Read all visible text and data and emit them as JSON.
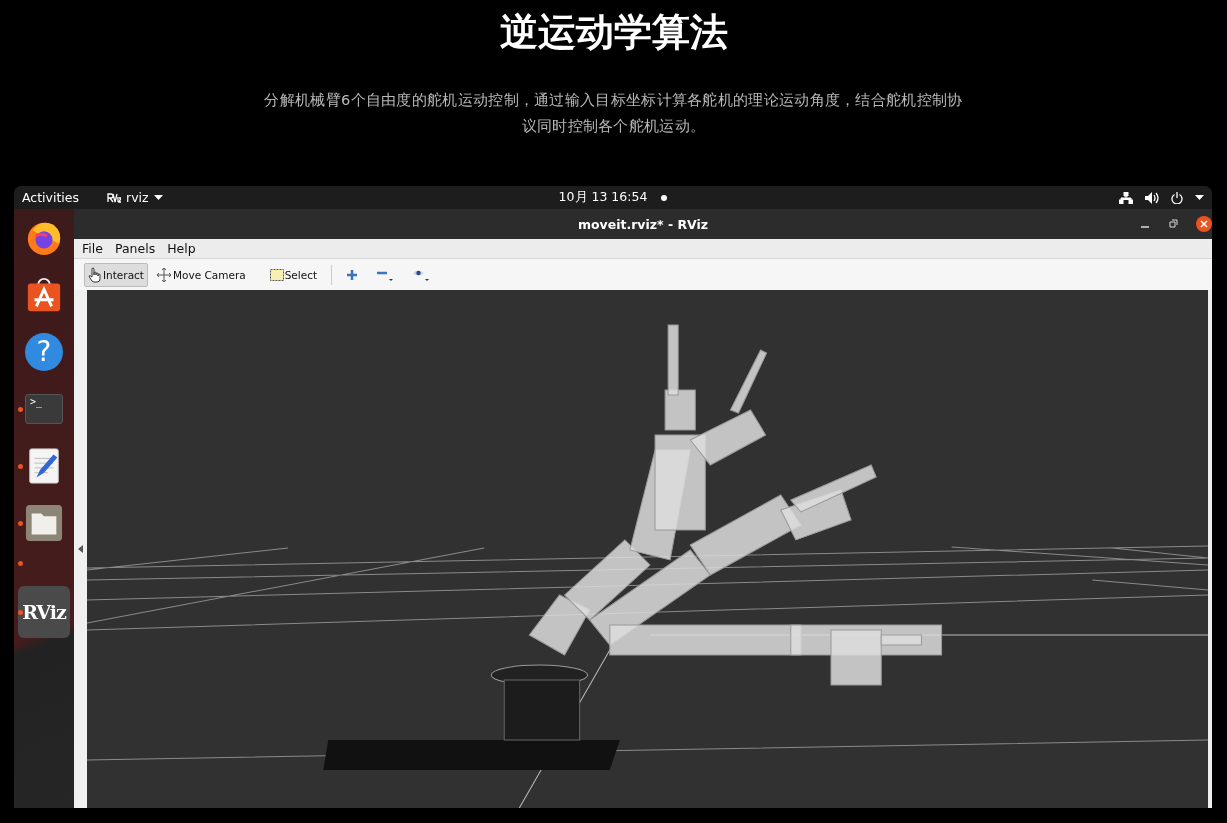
{
  "heading": "逆运动学算法",
  "description": "分解机械臂6个自由度的舵机运动控制，通过输入目标坐标计算各舵机的理论运动角度，结合舵机控制协议同时控制各个舵机运动。",
  "top_bar": {
    "activities": "Activities",
    "app_menu": "rviz",
    "clock": "10月 13  16:54"
  },
  "dock": [
    {
      "kind": "firefox",
      "running": false,
      "selected": false
    },
    {
      "kind": "software",
      "running": false,
      "selected": false
    },
    {
      "kind": "help",
      "label": "?",
      "running": false,
      "selected": false
    },
    {
      "kind": "terminal",
      "label": ">_",
      "running": true,
      "selected": false
    },
    {
      "kind": "editor",
      "running": true,
      "selected": false
    },
    {
      "kind": "files",
      "running": true,
      "selected": false
    },
    {
      "kind": "hidden",
      "running": true,
      "selected": false
    },
    {
      "kind": "rviz",
      "label": "RViz",
      "running": true,
      "selected": true
    }
  ],
  "window": {
    "title": "moveit.rviz* - RViz"
  },
  "menu": [
    "File",
    "Panels",
    "Help"
  ],
  "tools": [
    {
      "kind": "interact",
      "label": "Interact",
      "selected": true
    },
    {
      "kind": "move",
      "label": "Move Camera",
      "selected": false
    },
    {
      "kind": "select",
      "label": "Select",
      "selected": false
    },
    {
      "kind": "add",
      "selected": false
    },
    {
      "kind": "remove",
      "selected": false
    },
    {
      "kind": "view",
      "selected": false
    }
  ]
}
